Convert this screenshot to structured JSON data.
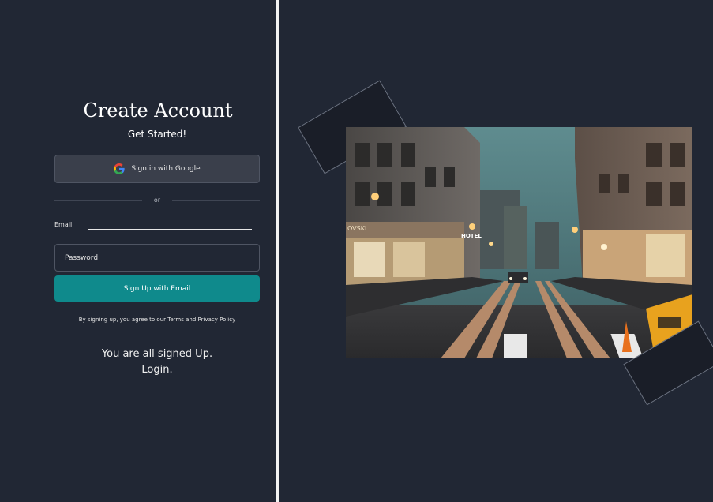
{
  "form": {
    "title": "Create Account",
    "subtitle": "Get Started!",
    "google_button_label": "Sign in with Google",
    "divider_text": "or",
    "email_label": "Email",
    "email_value": "",
    "password_placeholder": "Password",
    "password_value": "",
    "signup_button_label": "Sign Up with Email",
    "terms_prefix": "By signing up, you agree to our",
    "terms_link": "Terms",
    "terms_and": "and",
    "privacy_link": "Privacy Policy",
    "status_message": "You are all signed Up.",
    "login_link": "Login."
  },
  "photo": {
    "signs": [
      "OVSKI",
      "HOTEL"
    ]
  },
  "colors": {
    "background": "#212734",
    "accent_teal": "#0f8a8c",
    "divider": "#f2f2f2",
    "google_button_bg": "#3a3f4b"
  },
  "icons": {
    "google": "google-g-icon"
  }
}
